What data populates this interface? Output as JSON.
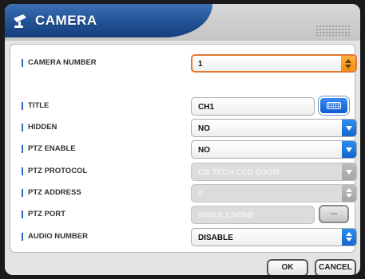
{
  "window": {
    "title": "CAMERA",
    "icon": "camera-icon"
  },
  "accent": {
    "blue": "#2b8ef0",
    "orange": "#e4762e"
  },
  "fields": {
    "camera_number": {
      "label": "CAMERA NUMBER",
      "value": "1"
    },
    "title": {
      "label": "TITLE",
      "value": "CH1"
    },
    "hidden": {
      "label": "HIDDEN",
      "value": "NO"
    },
    "ptz_enable": {
      "label": "PTZ ENABLE",
      "value": "NO"
    },
    "ptz_protocol": {
      "label": "PTZ PROTOCOL",
      "value": "CB TECH CCD ZOOM"
    },
    "ptz_address": {
      "label": "PTZ ADDRESS",
      "value": "0"
    },
    "ptz_port": {
      "label": "PTZ PORT",
      "value": "9600,8,1,NONE",
      "button": "..."
    },
    "audio_number": {
      "label": "AUDIO NUMBER",
      "value": "DISABLE"
    }
  },
  "footer": {
    "ok": "OK",
    "cancel": "CANCEL"
  }
}
